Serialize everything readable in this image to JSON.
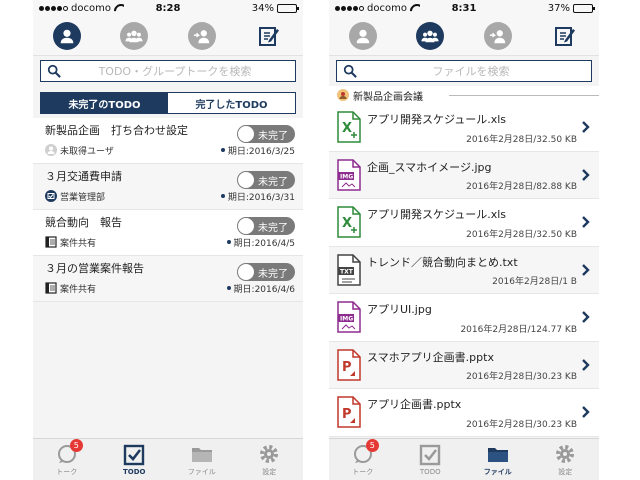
{
  "colors": {
    "primary": "#1e3a5f",
    "inactive": "#a8a8a8",
    "toggle": "#7a7a7a",
    "badge": "#e53935"
  },
  "left": {
    "status": {
      "carrier": "docomo",
      "time": "8:28",
      "battery": "34%",
      "battery_level": 0.34
    },
    "search_placeholder": "TODO・グループトークを検索",
    "segments": {
      "incomplete": "未完了のTODO",
      "complete": "完了したTODO"
    },
    "todos": [
      {
        "title": "新製品企画　打ち合わせ設定",
        "status": "未完了",
        "assignee": "未取得ユーザ",
        "assignee_icon": "user-icon",
        "due": "期日:2016/3/25"
      },
      {
        "title": "３月交通費申請",
        "status": "未完了",
        "assignee": "営業管理部",
        "assignee_icon": "group-icon",
        "due": "期日:2016/3/31"
      },
      {
        "title": "競合動向　報告",
        "status": "未完了",
        "assignee": "案件共有",
        "assignee_icon": "board-icon",
        "due": "期日:2016/4/5"
      },
      {
        "title": "３月の営業案件報告",
        "status": "未完了",
        "assignee": "案件共有",
        "assignee_icon": "board-icon",
        "due": "期日:2016/4/6"
      }
    ]
  },
  "right": {
    "status": {
      "carrier": "docomo",
      "time": "8:31",
      "battery": "37%",
      "battery_level": 0.37
    },
    "search_placeholder": "ファイルを検索",
    "group_name": "新製品企画会議",
    "files": [
      {
        "name": "アプリ開発スケジュール.xls",
        "info": "2016年2月28日/32.50 KB",
        "type": "xls"
      },
      {
        "name": "企画_スマホイメージ.jpg",
        "info": "2016年2月28日/82.88 KB",
        "type": "img"
      },
      {
        "name": "アプリ開発スケジュール.xls",
        "info": "2016年2月28日/32.50 KB",
        "type": "xls"
      },
      {
        "name": "トレンド／競合動向まとめ.txt",
        "info": "2016年2月28日/1 B",
        "type": "txt"
      },
      {
        "name": "アプリUI.jpg",
        "info": "2016年2月28日/124.77 KB",
        "type": "img"
      },
      {
        "name": "スマホアプリ企画書.pptx",
        "info": "2016年2月28日/30.23 KB",
        "type": "ppt"
      },
      {
        "name": "アプリ企画書.pptx",
        "info": "2016年2月28日/30.23 KB",
        "type": "ppt"
      }
    ]
  },
  "tabs": {
    "talk": "トーク",
    "todo": "TODO",
    "file": "ファイル",
    "settings": "設定",
    "badge": "5"
  }
}
